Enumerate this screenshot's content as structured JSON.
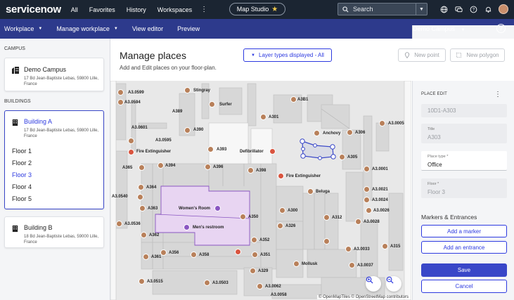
{
  "topbar": {
    "logo_text": "servicenow",
    "nav": [
      "All",
      "Favorites",
      "History",
      "Workspaces"
    ],
    "app_pill": "Map Studio",
    "search_label": "Search"
  },
  "subbar": {
    "items": [
      "Workplace",
      "Manage workplace",
      "View editor",
      "Preview"
    ],
    "campus_selector": "Demo Campus"
  },
  "left": {
    "campus_heading": "CAMPUS",
    "campus": {
      "name": "Demo Campus",
      "address": "17 Bd Jean-Baptiste Lebas, 59800 Lille, France"
    },
    "buildings_heading": "BUILDINGS",
    "building_a": {
      "name": "Building A",
      "address": "17 Bd Jean-Baptiste Lebas, 59800 Lille, France"
    },
    "floors": [
      "Floor 1",
      "Floor 2",
      "Floor 3",
      "Floor 4",
      "Floor 5"
    ],
    "selected_floor": "Floor 3",
    "building_b": {
      "name": "Building B",
      "address": "18 Bd Jean-Baptiste Lebas, 59000 Lille, France"
    }
  },
  "header": {
    "title": "Manage places",
    "subtitle": "Add and Edit places on your floor-plan.",
    "layer_types_button": "Layer types displayed - All",
    "new_point_button": "New point",
    "new_polygon_button": "New polygon"
  },
  "map": {
    "labels": [
      "A3.0599",
      "A3.0594",
      "A389",
      "A390",
      "Stingray",
      "Surfer",
      "A3B1",
      "A301",
      "Anchovy",
      "A306",
      "A3.0005",
      "A3.0601",
      "A3.0595",
      "Fire Extinguisher",
      "A393",
      "Defibrillator",
      "A305",
      "A3.0001",
      "A365",
      "A394",
      "A396",
      "A398",
      "Fire Extinguisher",
      "A364",
      "Beluga",
      "A3.0021",
      "A3.0540",
      "A3.0024",
      "A363",
      "Women's Room",
      "A300",
      "A312",
      "A3.0026",
      "A3.0536",
      "A350",
      "A3.0028",
      "Men's restroom",
      "A326",
      "A362",
      "A352",
      "A3.0033",
      "A315",
      "A356",
      "A358",
      "A351",
      "A361",
      "Mollusk",
      "A3.0037",
      "A329",
      "A3.0515",
      "A3.0503",
      "A3.0062",
      "A3.0058"
    ],
    "attribution": "© OpenMapTiles © OpenStreetMap contributors"
  },
  "panel": {
    "title": "PLACE EDIT",
    "id_value": "10D1-A303",
    "title_label": "Title",
    "title_value": "A303",
    "place_type_label": "Place type *",
    "place_type_value": "Office",
    "floor_label": "Floor *",
    "floor_value": "Floor 3",
    "markers_heading": "Markers & Entrances",
    "add_marker": "Add a marker",
    "add_entrance": "Add an entrance",
    "save": "Save",
    "cancel": "Cancel"
  },
  "colors": {
    "topbar": "#1b2532",
    "subbar": "#2d3a8c",
    "accent": "#2d3ae0",
    "restroom_fill": "#e8d5f2"
  }
}
